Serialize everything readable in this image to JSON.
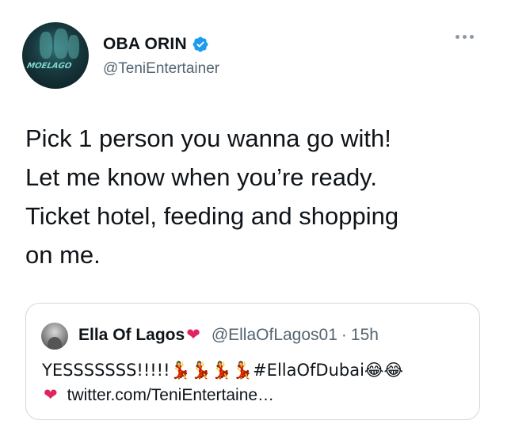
{
  "tweet": {
    "author": {
      "display_name": "OBA ORIN",
      "handle": "@TeniEntertainer",
      "verified": true,
      "avatar_text": "MOELAGO"
    },
    "text": "Pick 1 person you wanna go with!\nLet me know when you’re ready.\nTicket hotel, feeding and shopping\non me.",
    "menu_icon": "more-icon"
  },
  "quote": {
    "author": {
      "display_name": "Ella Of Lagos",
      "name_emoji": "❤",
      "handle": "@EllaOfLagos01",
      "separator": "·",
      "time": "15h"
    },
    "line1": "YESSSSSSS!!!!!💃💃💃💃#EllaOfDubai😂😂",
    "line2_emoji": "❤",
    "link": "twitter.com/TeniEntertaine…"
  },
  "colors": {
    "text": "#0f1419",
    "secondary": "#536471",
    "verified": "#1d9bf0",
    "border": "#cfd9de",
    "heart": "#e0245e"
  }
}
